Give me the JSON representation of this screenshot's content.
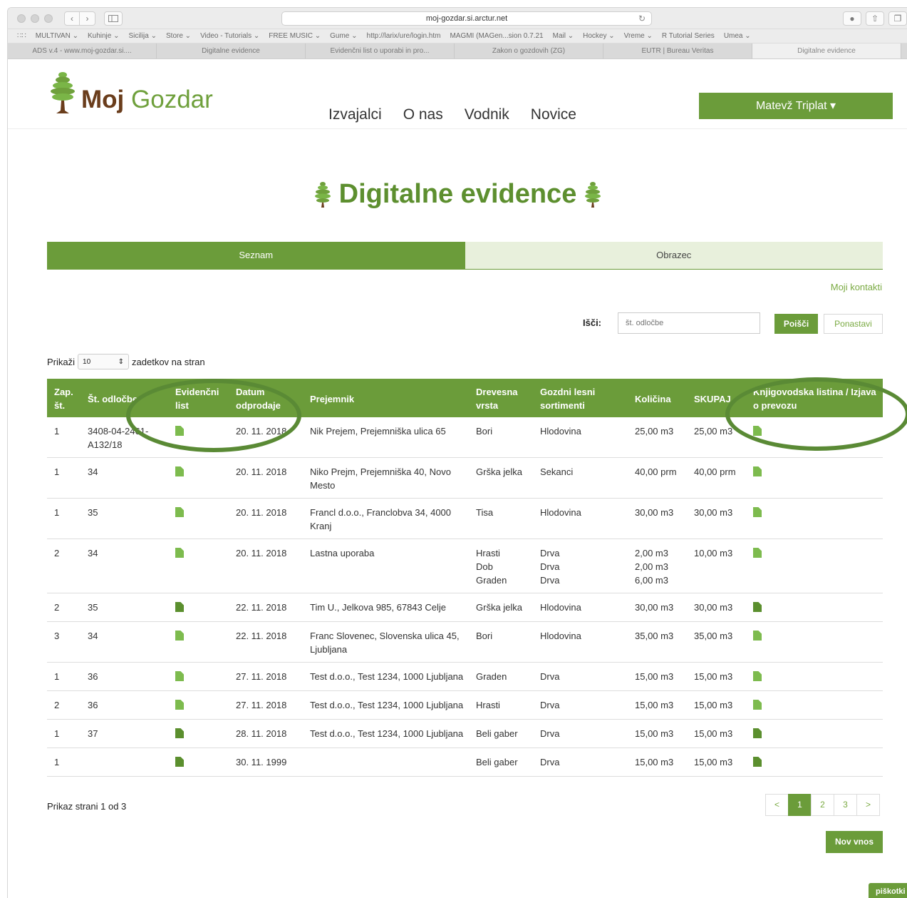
{
  "browser": {
    "url": "moj-gozdar.si.arctur.net",
    "bookmarks": [
      "MULTIVAN ⌄",
      "Kuhinje ⌄",
      "Sicilija ⌄",
      "Store ⌄",
      "Video - Tutorials ⌄",
      "FREE MUSIC ⌄",
      "Gume ⌄",
      "http://larix/ure/login.htm",
      "MAGMI (MAGen...sion 0.7.21",
      "Mail ⌄",
      "Hockey ⌄",
      "Vreme ⌄",
      "R Tutorial Series",
      "Umea ⌄"
    ],
    "tabs": [
      "ADS v.4 - www.moj-gozdar.si....",
      "Digitalne evidence",
      "Evidenčni list o uporabi in pro...",
      "Zakon o gozdovih (ZG)",
      "EUTR | Bureau Veritas",
      "Digitalne evidence"
    ]
  },
  "header": {
    "logo_bold": "Moj",
    "logo_light": "Gozdar",
    "nav": [
      "Izvajalci",
      "O nas",
      "Vodnik",
      "Novice"
    ],
    "user": "Matevž Triplat ▾"
  },
  "page": {
    "title": "Digitalne evidence",
    "tab_list": "Seznam",
    "tab_form": "Obrazec",
    "contacts": "Moji kontakti",
    "search_label": "Išči:",
    "search_placeholder": "št. odločbe",
    "search_button": "Poišči",
    "reset_button": "Ponastavi",
    "show_prefix": "Prikaži",
    "per_page": "10",
    "show_suffix": "zadetkov na stran",
    "page_info": "Prikaz strani 1 od 3",
    "pages": [
      "<",
      "1",
      "2",
      "3",
      ">"
    ],
    "new_entry": "Nov vnos",
    "cookies": "piškotki"
  },
  "table": {
    "headers": {
      "zap": "Zap. št.",
      "odlocba": "Št. odločbe",
      "evidencni": "Evidenčni list",
      "datum": "Datum odprodaje",
      "prejemnik": "Prejemnik",
      "vrsta": "Drevesna vrsta",
      "sortimenti": "Gozdni lesni sortimenti",
      "kolicina": "Količina",
      "skupaj": "SKUPAJ",
      "listina": "Knjigovodska listina / Izjava o prevozu"
    },
    "rows": [
      {
        "zap": "1",
        "odlocba": "3408-04-2461-A132/18",
        "datum": "20. 11. 2018",
        "prejemnik": "Nik Prejem, Prejemniška ulica 65",
        "vrsta": "Bori",
        "sortimenti": "Hlodovina",
        "kolicina": "25,00 m3",
        "skupaj": "25,00 m3"
      },
      {
        "zap": "1",
        "odlocba": "34",
        "datum": "20. 11. 2018",
        "prejemnik": "Niko Prejm, Prejemniška 40, Novo Mesto",
        "vrsta": "Grška jelka",
        "sortimenti": "Sekanci",
        "kolicina": "40,00 prm",
        "skupaj": "40,00 prm"
      },
      {
        "zap": "1",
        "odlocba": "35",
        "datum": "20. 11. 2018",
        "prejemnik": "Francl d.o.o., Franclobva 34, 4000 Kranj",
        "vrsta": "Tisa",
        "sortimenti": "Hlodovina",
        "kolicina": "30,00 m3",
        "skupaj": "30,00 m3"
      },
      {
        "zap": "2",
        "odlocba": "34",
        "datum": "20. 11. 2018",
        "prejemnik": "Lastna uporaba",
        "vrsta": "Hrasti\nDob\nGraden",
        "sortimenti": "Drva\nDrva\nDrva",
        "kolicina": "2,00 m3\n2,00 m3\n6,00 m3",
        "skupaj": "10,00 m3"
      },
      {
        "zap": "2",
        "odlocba": "35",
        "datum": "22. 11. 2018",
        "prejemnik": "Tim U., Jelkova 985, 67843 Celje",
        "vrsta": "Grška jelka",
        "sortimenti": "Hlodovina",
        "kolicina": "30,00 m3",
        "skupaj": "30,00 m3"
      },
      {
        "zap": "3",
        "odlocba": "34",
        "datum": "22. 11. 2018",
        "prejemnik": "Franc Slovenec, Slovenska ulica 45, Ljubljana",
        "vrsta": "Bori",
        "sortimenti": "Hlodovina",
        "kolicina": "35,00 m3",
        "skupaj": "35,00 m3"
      },
      {
        "zap": "1",
        "odlocba": "36",
        "datum": "27. 11. 2018",
        "prejemnik": "Test d.o.o., Test 1234, 1000 Ljubljana",
        "vrsta": "Graden",
        "sortimenti": "Drva",
        "kolicina": "15,00 m3",
        "skupaj": "15,00 m3"
      },
      {
        "zap": "2",
        "odlocba": "36",
        "datum": "27. 11. 2018",
        "prejemnik": "Test d.o.o., Test 1234, 1000 Ljubljana",
        "vrsta": "Hrasti",
        "sortimenti": "Drva",
        "kolicina": "15,00 m3",
        "skupaj": "15,00 m3"
      },
      {
        "zap": "1",
        "odlocba": "37",
        "datum": "28. 11. 2018",
        "prejemnik": "Test d.o.o., Test 1234, 1000 Ljubljana",
        "vrsta": "Beli gaber",
        "sortimenti": "Drva",
        "kolicina": "15,00 m3",
        "skupaj": "15,00 m3"
      },
      {
        "zap": "1",
        "odlocba": "",
        "datum": "30. 11. 1999",
        "prejemnik": "",
        "vrsta": "Beli gaber",
        "sortimenti": "Drva",
        "kolicina": "15,00 m3",
        "skupaj": "15,00 m3"
      }
    ]
  },
  "colors": {
    "brand_green": "#6b9c3a",
    "brand_brown": "#6a3d1c",
    "highlight_ring": "#5a8a35"
  }
}
